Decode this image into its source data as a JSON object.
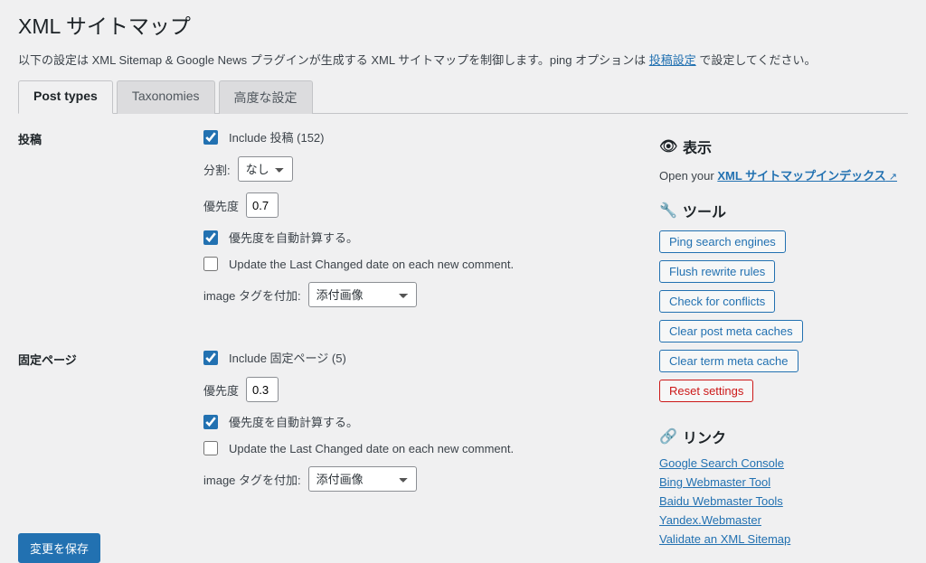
{
  "page": {
    "title": "XML サイトマップ",
    "description_pre": "以下の設定は XML Sitemap & Google News プラグインが生成する XML サイトマップを制御します。ping オプションは ",
    "description_link": "投稿設定",
    "description_post": " で設定してください。"
  },
  "tabs": [
    "Post types",
    "Taxonomies",
    "高度な設定"
  ],
  "sections": {
    "posts": {
      "heading": "投稿",
      "include_label": "Include 投稿 (152)",
      "split_label": "分割:",
      "split_value": "なし",
      "priority_label": "優先度",
      "priority_value": "0.7",
      "autocalc_label": "優先度を自動計算する。",
      "update_label": "Update the Last Changed date on each new comment.",
      "image_label": "image タグを付加:",
      "image_value": "添付画像"
    },
    "pages": {
      "heading": "固定ページ",
      "include_label": "Include 固定ページ (5)",
      "priority_label": "優先度",
      "priority_value": "0.3",
      "autocalc_label": "優先度を自動計算する。",
      "update_label": "Update the Last Changed date on each new comment.",
      "image_label": "image タグを付加:",
      "image_value": "添付画像"
    }
  },
  "submit": "変更を保存",
  "sidebar": {
    "display": {
      "title": "表示",
      "open_your": "Open your ",
      "link": "XML サイトマップインデックス"
    },
    "tools": {
      "title": "ツール",
      "buttons": [
        "Ping search engines",
        "Flush rewrite rules",
        "Check for conflicts",
        "Clear post meta caches",
        "Clear term meta cache"
      ],
      "reset": "Reset settings"
    },
    "links": {
      "title": "リンク",
      "items": [
        "Google Search Console",
        "Bing Webmaster Tool",
        "Baidu Webmaster Tools",
        "Yandex.Webmaster",
        "Validate an XML Sitemap"
      ]
    }
  }
}
